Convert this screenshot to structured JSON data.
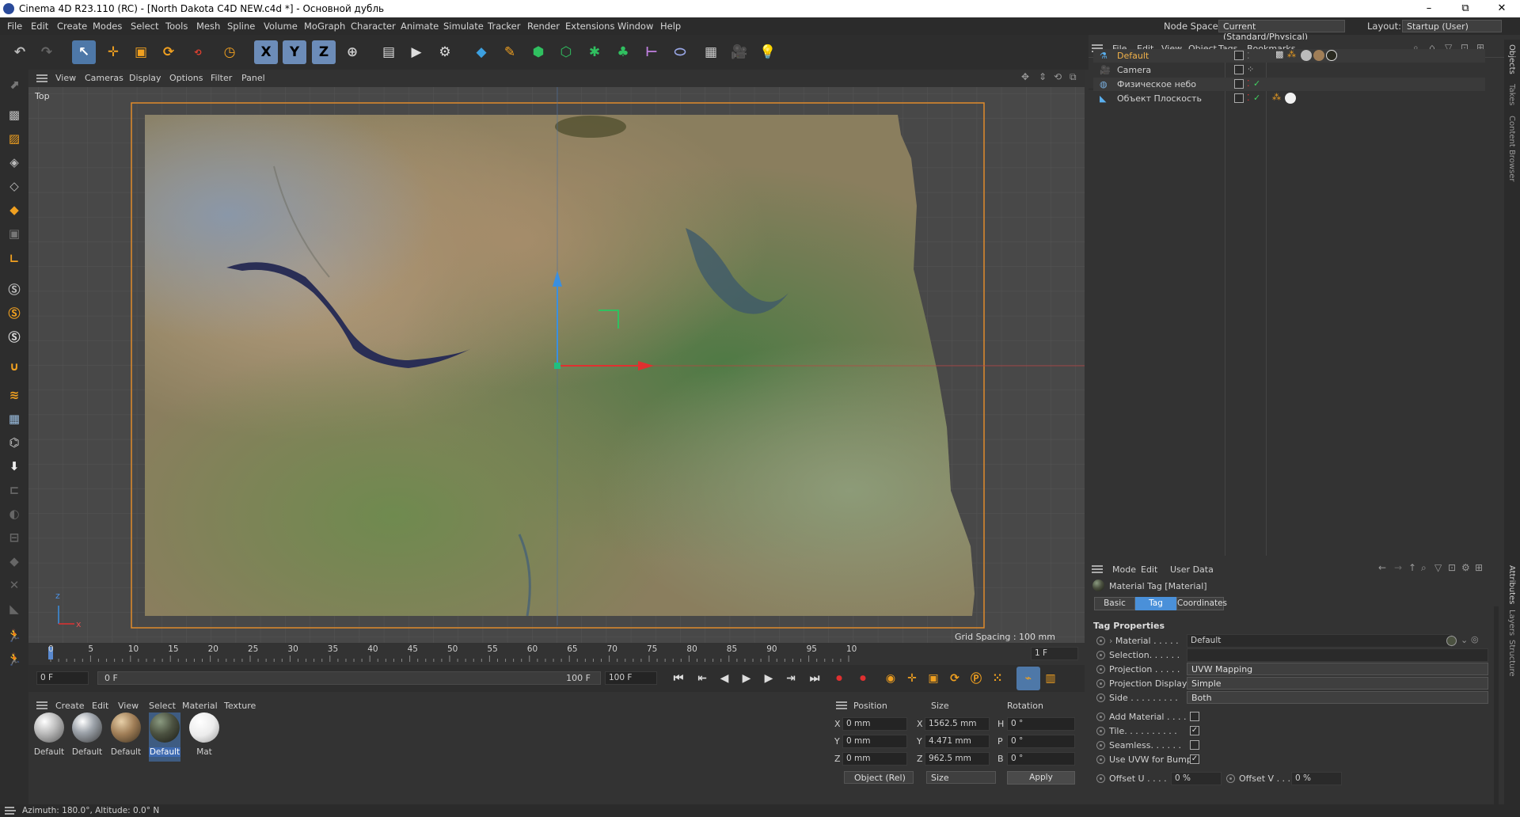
{
  "window": {
    "title": "Cinema 4D R23.110 (RC) - [North Dakota C4D NEW.c4d *] - Основной дубль",
    "minimize": "–",
    "maximize": "⧉",
    "close": "✕"
  },
  "menu": [
    "File",
    "Edit",
    "Create",
    "Modes",
    "Select",
    "Tools",
    "Mesh",
    "Spline",
    "Volume",
    "MoGraph",
    "Character",
    "Animate",
    "Simulate",
    "Tracker",
    "Render",
    "Extensions",
    "Window",
    "Help"
  ],
  "nodespace": {
    "label": "Node Space:",
    "value": "Current (Standard/Physical)"
  },
  "layout": {
    "label": "Layout:",
    "value": "Startup (User)"
  },
  "viewport": {
    "menu": [
      "View",
      "Cameras",
      "Display",
      "Options",
      "Filter",
      "Panel"
    ],
    "view_name": "Top",
    "grid_spacing": "Grid Spacing : 100 mm",
    "axis_x": "x",
    "axis_z": "z"
  },
  "timeline": {
    "ticks": [
      "0",
      "5",
      "10",
      "15",
      "20",
      "25",
      "30",
      "35",
      "40",
      "45",
      "50",
      "55",
      "60",
      "65",
      "70",
      "75",
      "80",
      "85",
      "90",
      "95",
      "10"
    ],
    "current_frame": "1 F",
    "start": "0 F",
    "range_start": "0 F",
    "range_end": "100 F",
    "end": "100 F"
  },
  "material_manager": {
    "menu": [
      "Create",
      "Edit",
      "View",
      "Select",
      "Material",
      "Texture"
    ],
    "materials": [
      {
        "name": "Default",
        "color": "#bfbfbf"
      },
      {
        "name": "Default",
        "color": "#9da3aa"
      },
      {
        "name": "Default",
        "color": "#a07e57"
      },
      {
        "name": "Default",
        "color": "#4b5140"
      },
      {
        "name": "Mat",
        "color": "#ececec"
      }
    ]
  },
  "coordinates": {
    "headers": [
      "Position",
      "Size",
      "Rotation"
    ],
    "rows": [
      {
        "axis": "X",
        "pos": "0 mm",
        "saxis": "X",
        "size": "1562.5 mm",
        "raxis": "H",
        "rot": "0 °"
      },
      {
        "axis": "Y",
        "pos": "0 mm",
        "saxis": "Y",
        "size": "4.471 mm",
        "raxis": "P",
        "rot": "0 °"
      },
      {
        "axis": "Z",
        "pos": "0 mm",
        "saxis": "Z",
        "size": "962.5 mm",
        "raxis": "B",
        "rot": "0 °"
      }
    ],
    "mode": "Object (Rel)",
    "size_mode": "Size",
    "apply": "Apply"
  },
  "object_manager": {
    "menu": [
      "File",
      "Edit",
      "View",
      "Object",
      "Tags",
      "Bookmarks"
    ],
    "objects": [
      {
        "name": "Default",
        "selected": true
      },
      {
        "name": "Camera",
        "selected": false
      },
      {
        "name": "Физическое небо",
        "selected": false
      },
      {
        "name": "Объект Плоскость",
        "selected": false
      }
    ]
  },
  "attributes": {
    "menu": [
      "Mode",
      "Edit",
      "User Data"
    ],
    "title": "Material Tag [Material]",
    "tabs": [
      "Basic",
      "Tag",
      "Coordinates"
    ],
    "active_tab": "Tag",
    "section": "Tag Properties",
    "fields": [
      {
        "label": "Material . . . . .",
        "value": "Default"
      },
      {
        "label": "Selection. . . . . .",
        "value": ""
      },
      {
        "label": "Projection . . . . .",
        "value": "UVW Mapping"
      },
      {
        "label": "Projection Display",
        "value": "Simple"
      },
      {
        "label": "Side . . . . . . . . .",
        "value": "Both"
      }
    ],
    "checks": [
      {
        "label": "Add Material . . . .",
        "checked": false
      },
      {
        "label": "Tile. . . . . . . . . .",
        "checked": true
      },
      {
        "label": "Seamless. . . . . .",
        "checked": false
      },
      {
        "label": "Use UVW for Bump",
        "checked": true
      }
    ],
    "offset_u": {
      "label": "Offset U . . . .",
      "value": "0 %"
    },
    "offset_v": {
      "label": "Offset V . . . .",
      "value": "0 %"
    }
  },
  "right_tabs": [
    "Objects",
    "Takes",
    "Content Browser",
    "Attributes",
    "Layers",
    "Structure"
  ],
  "status": "Azimuth: 180.0°, Altitude: 0.0°  N"
}
